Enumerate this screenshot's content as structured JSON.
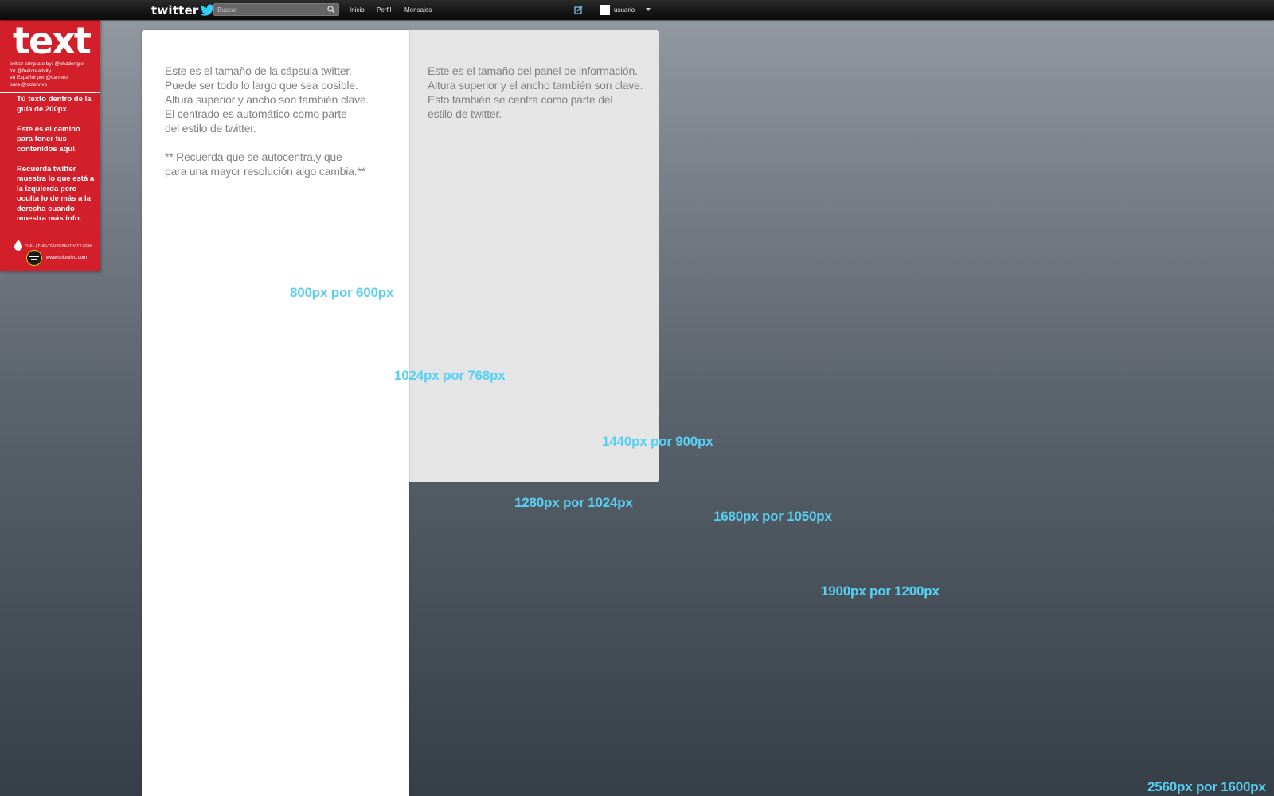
{
  "topbar": {
    "logo_text": "twitter",
    "search": {
      "placeholder": "Buscar",
      "value": ""
    },
    "nav": {
      "home": "Inicio",
      "profile": "Perfil",
      "messages": "Mensajes"
    },
    "username": "usuario"
  },
  "badge": {
    "title": "text",
    "credits": [
      "twitter template by: @chadengle",
      "for @fuelcreativity",
      "en Español por @carrero",
      "para @colorvivo"
    ],
    "notes": [
      "Tú texto dentro de la guía de 200px.",
      "Este es el camino para tener tus contenidos aquí.",
      "Recuerda twitter muestra lo que está a la izquierda pero oculta lo de más a la derecha cuando muestra más info."
    ],
    "fuel_text": "FUEL | FUELYOURCREATIVITY.COM",
    "colorvivo_url": "www.colorvivo.com"
  },
  "capsule": {
    "lines": [
      "Este es el tamaño de la cápsula twitter.",
      "Puede ser todo lo largo que sea posible.",
      "Altura superior y ancho son también clave.",
      "El centrado es automático como parte",
      "del estilo de twitter."
    ],
    "note_lines": [
      "** Recuerda que se autocentra,y que",
      "para una mayor resolución algo cambia.**"
    ]
  },
  "info_panel": {
    "lines": [
      "Este es el tamaño del panel de información.",
      "Altura superior y el ancho también son clave.",
      "Esto también se centra como parte del",
      "estilo de twitter."
    ]
  },
  "resolutions": [
    "800px por 600px",
    "1024px por 768px",
    "1440px por 900px",
    "1280px por 1024px",
    "1680px por 1050px",
    "1900px por 1200px",
    "2560px por 1600px"
  ],
  "colors": {
    "badge_red": "#d21f29",
    "resolution_blue": "#58d0f4",
    "topbar": "#151515",
    "twitter_blue": "#33ccff"
  },
  "icons": [
    "twitter-bird-icon",
    "search-icon",
    "compose-icon",
    "caret-down-icon",
    "drop-icon",
    "colorvivo-logo-icon"
  ]
}
